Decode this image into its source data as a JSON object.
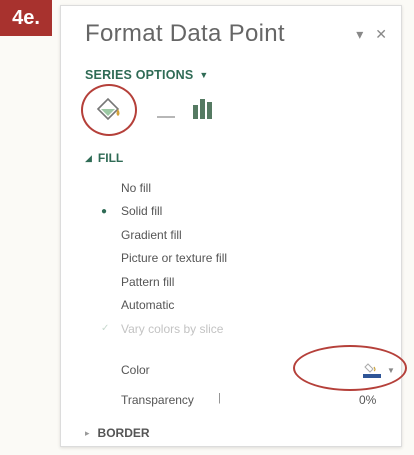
{
  "step_label": "4e.",
  "pane": {
    "title": "Format Data Point",
    "dropdown_icon": "chevron-down-icon",
    "close_icon": "close-icon"
  },
  "series_options": {
    "label": "SERIES OPTIONS",
    "tabs": [
      {
        "icon": "paint-bucket-icon",
        "active": true
      },
      {
        "icon": "effects-icon",
        "active": false
      },
      {
        "icon": "bar-chart-icon",
        "active": false
      }
    ]
  },
  "fill_section": {
    "title": "FILL",
    "options": [
      {
        "label": "No fill",
        "selected": false,
        "enabled": true
      },
      {
        "label": "Solid fill",
        "selected": true,
        "enabled": true
      },
      {
        "label": "Gradient fill",
        "selected": false,
        "enabled": true
      },
      {
        "label": "Picture or texture fill",
        "selected": false,
        "enabled": true
      },
      {
        "label": "Pattern fill",
        "selected": false,
        "enabled": true
      },
      {
        "label": "Automatic",
        "selected": false,
        "enabled": true
      },
      {
        "label": "Vary colors by slice",
        "selected": false,
        "enabled": false
      }
    ]
  },
  "color": {
    "label": "Color",
    "swatch": "#2f5597"
  },
  "transparency": {
    "label": "Transparency",
    "value": "0%"
  },
  "border_section": {
    "title": "BORDER"
  },
  "colors": {
    "accent_green": "#2f6b55",
    "highlight_red": "#b5403a",
    "badge_red": "#a8322e"
  }
}
